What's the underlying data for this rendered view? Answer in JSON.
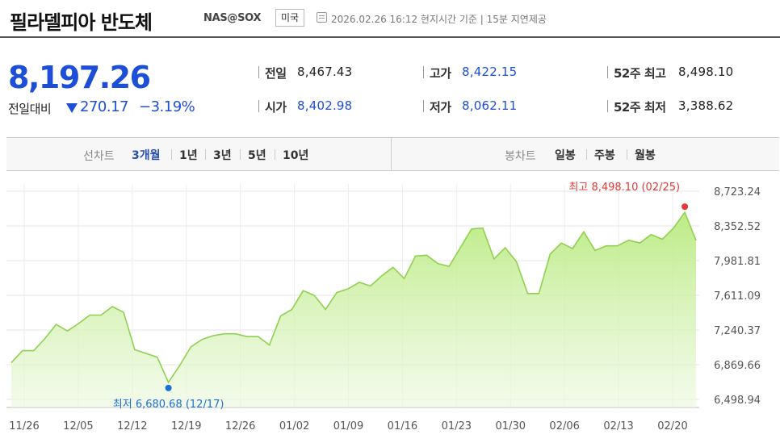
{
  "header": {
    "title": "필라델피아 반도체",
    "code": "NAS@SOX",
    "market": "미국",
    "timestamp": "2026.02.26 16:12 현지시간 기준  |  15분 지연제공"
  },
  "quote": {
    "price": "8,197.26",
    "change_label": "전일대비",
    "change": "270.17",
    "change_rate": "−3.19%",
    "direction": "down",
    "colors": {
      "down": "#1d4ed8",
      "high_marker": "#e53935",
      "low_marker": "#1d6fd6",
      "line": "#8fd14f"
    }
  },
  "stats": [
    {
      "label": "전일",
      "value": "8,467.43"
    },
    {
      "label": "고가",
      "value": "8,422.15"
    },
    {
      "label": "52주 최고",
      "value": "8,498.10"
    },
    {
      "label": "시가",
      "value": "8,402.98"
    },
    {
      "label": "저가",
      "value": "8,062.11"
    },
    {
      "label": "52주 최저",
      "value": "3,388.62"
    }
  ],
  "tabs": {
    "line_label": "선차트",
    "line_periods": [
      "3개월",
      "1년",
      "3년",
      "5년",
      "10년"
    ],
    "active_period": "3개월",
    "candle_label": "봉차트",
    "candle_periods": [
      "일봉",
      "주봉",
      "월봉"
    ]
  },
  "chart_data": {
    "type": "area",
    "ylim": [
      6498.94,
      8723.24
    ],
    "y_ticks": [
      "8,723.24",
      "8,352.52",
      "7,981.81",
      "7,611.09",
      "7,240.37",
      "6,869.66",
      "6,498.94"
    ],
    "x_ticks": [
      "11/26",
      "12/05",
      "12/12",
      "12/19",
      "12/26",
      "01/02",
      "01/09",
      "01/16",
      "01/23",
      "01/30",
      "02/06",
      "02/13",
      "02/20"
    ],
    "grid": true,
    "high_label": "최고 8,498.10 (02/25)",
    "low_label": "최저 6,680.68 (12/17)",
    "series": [
      {
        "values": [
          6890,
          7020,
          7020,
          7150,
          7300,
          7230,
          7310,
          7400,
          7400,
          7490,
          7430,
          7030,
          6990,
          6950,
          6681,
          6860,
          7060,
          7140,
          7180,
          7200,
          7200,
          7170,
          7170,
          7080,
          7390,
          7460,
          7660,
          7610,
          7460,
          7640,
          7680,
          7750,
          7710,
          7820,
          7910,
          7790,
          8030,
          8040,
          7950,
          7920,
          8120,
          8320,
          8330,
          8000,
          8120,
          7970,
          7630,
          7630,
          8050,
          8170,
          8110,
          8290,
          8090,
          8140,
          8140,
          8200,
          8170,
          8260,
          8210,
          8330,
          8498,
          8197
        ]
      }
    ]
  }
}
